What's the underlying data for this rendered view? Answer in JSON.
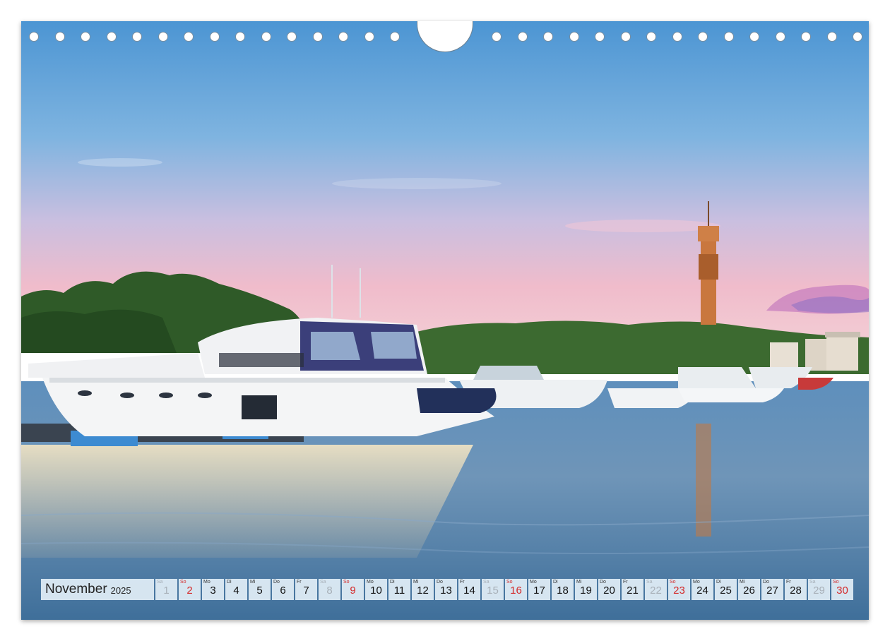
{
  "calendar": {
    "month": "November",
    "year": "2025",
    "days": [
      {
        "dow": "Sa",
        "num": "1",
        "type": "sat"
      },
      {
        "dow": "So",
        "num": "2",
        "type": "sun"
      },
      {
        "dow": "Mo",
        "num": "3",
        "type": "wd"
      },
      {
        "dow": "Di",
        "num": "4",
        "type": "wd"
      },
      {
        "dow": "Mi",
        "num": "5",
        "type": "wd"
      },
      {
        "dow": "Do",
        "num": "6",
        "type": "wd"
      },
      {
        "dow": "Fr",
        "num": "7",
        "type": "wd"
      },
      {
        "dow": "Sa",
        "num": "8",
        "type": "sat"
      },
      {
        "dow": "So",
        "num": "9",
        "type": "sun"
      },
      {
        "dow": "Mo",
        "num": "10",
        "type": "wd"
      },
      {
        "dow": "Di",
        "num": "11",
        "type": "wd"
      },
      {
        "dow": "Mi",
        "num": "12",
        "type": "wd"
      },
      {
        "dow": "Do",
        "num": "13",
        "type": "wd"
      },
      {
        "dow": "Fr",
        "num": "14",
        "type": "wd"
      },
      {
        "dow": "Sa",
        "num": "15",
        "type": "sat"
      },
      {
        "dow": "So",
        "num": "16",
        "type": "sun"
      },
      {
        "dow": "Mo",
        "num": "17",
        "type": "wd"
      },
      {
        "dow": "Di",
        "num": "18",
        "type": "wd"
      },
      {
        "dow": "Mi",
        "num": "19",
        "type": "wd"
      },
      {
        "dow": "Do",
        "num": "20",
        "type": "wd"
      },
      {
        "dow": "Fr",
        "num": "21",
        "type": "wd"
      },
      {
        "dow": "Sa",
        "num": "22",
        "type": "sat"
      },
      {
        "dow": "So",
        "num": "23",
        "type": "sun"
      },
      {
        "dow": "Mo",
        "num": "24",
        "type": "wd"
      },
      {
        "dow": "Di",
        "num": "25",
        "type": "wd"
      },
      {
        "dow": "Mi",
        "num": "26",
        "type": "wd"
      },
      {
        "dow": "Do",
        "num": "27",
        "type": "wd"
      },
      {
        "dow": "Fr",
        "num": "28",
        "type": "wd"
      },
      {
        "dow": "Sa",
        "num": "29",
        "type": "sat"
      },
      {
        "dow": "So",
        "num": "30",
        "type": "sun"
      }
    ]
  },
  "colors": {
    "sky_top": "#5b9fd6",
    "sky_pink": "#eab7c6",
    "water": "#5d8db6",
    "sunday": "#d42a2a",
    "saturday": "#a8b0b8",
    "cell_bg": "#e1eef6"
  }
}
